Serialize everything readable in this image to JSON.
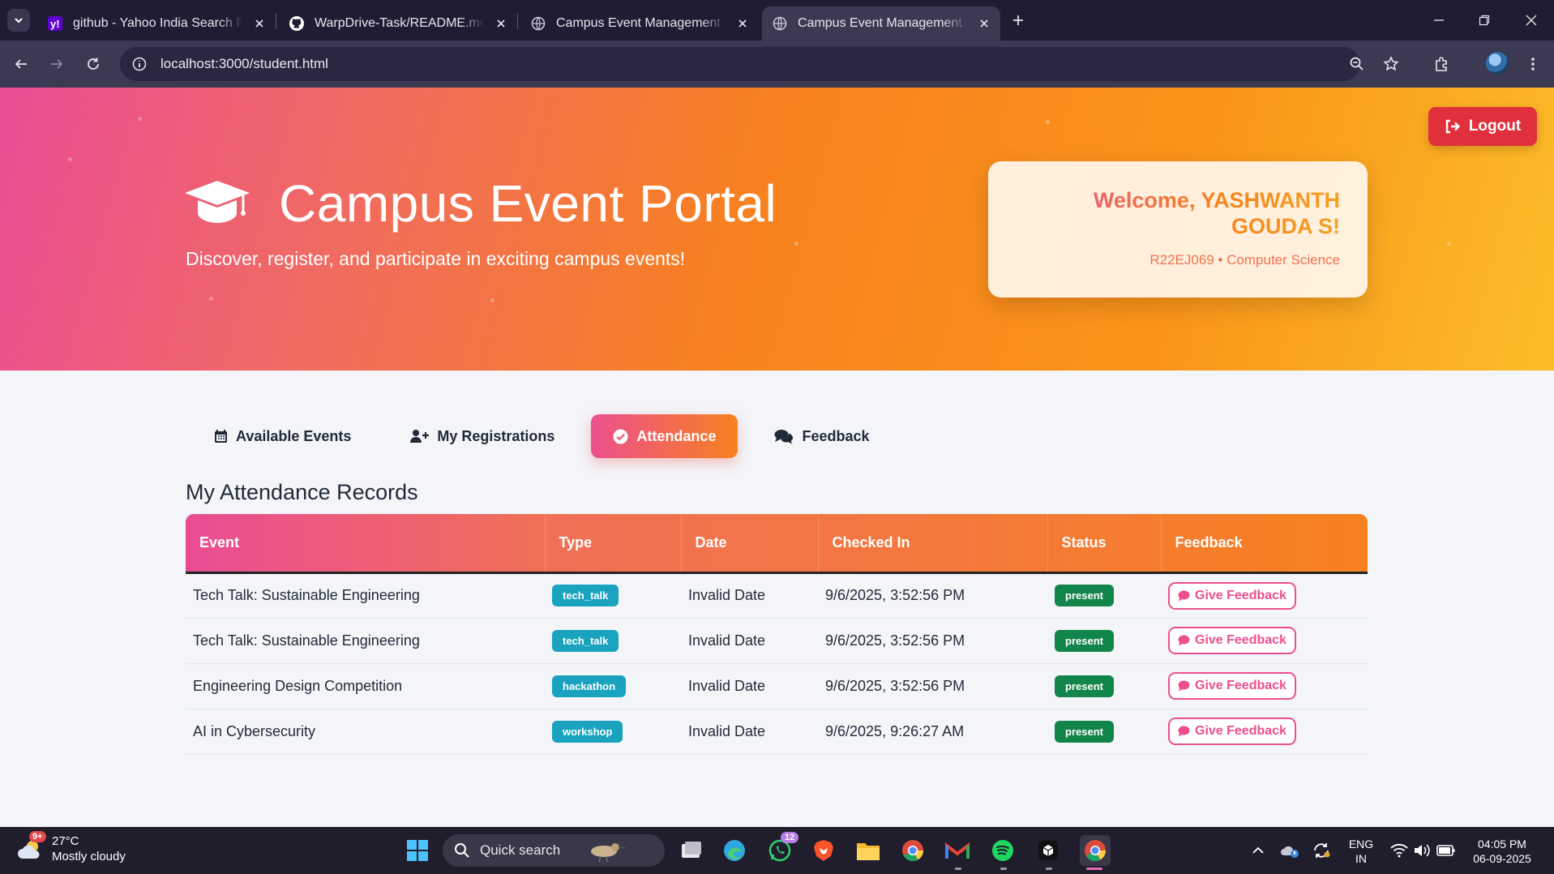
{
  "browser": {
    "tabs": [
      {
        "title": "github - Yahoo India Search Res",
        "icon": "yahoo-favicon"
      },
      {
        "title": "WarpDrive-Task/README.md at",
        "icon": "github-favicon"
      },
      {
        "title": "Campus Event Management Pla",
        "icon": "globe-favicon"
      },
      {
        "title": "Campus Event Management - S",
        "icon": "globe-favicon",
        "active": true
      }
    ],
    "url": "localhost:3000/student.html"
  },
  "hero": {
    "title": "Campus Event Portal",
    "tagline": "Discover, register, and participate in exciting campus events!",
    "logout_label": "Logout",
    "welcome_title": "Welcome, YASHWANTH GOUDA S!",
    "welcome_meta": "R22EJ069 • Computer Science"
  },
  "tabs": [
    {
      "label": "Available Events",
      "icon": "calendar-icon"
    },
    {
      "label": "My Registrations",
      "icon": "user-plus-icon"
    },
    {
      "label": "Attendance",
      "icon": "check-circle-icon",
      "active": true
    },
    {
      "label": "Feedback",
      "icon": "comments-icon"
    }
  ],
  "attendance": {
    "title": "My Attendance Records",
    "columns": [
      "Event",
      "Type",
      "Date",
      "Checked In",
      "Status",
      "Feedback"
    ],
    "rows": [
      {
        "event": "Tech Talk: Sustainable Engineering",
        "type": "tech_talk",
        "date": "Invalid Date",
        "checked_in": "9/6/2025, 3:52:56 PM",
        "status": "present",
        "action": "Give Feedback"
      },
      {
        "event": "Tech Talk: Sustainable Engineering",
        "type": "tech_talk",
        "date": "Invalid Date",
        "checked_in": "9/6/2025, 3:52:56 PM",
        "status": "present",
        "action": "Give Feedback"
      },
      {
        "event": "Engineering Design Competition",
        "type": "hackathon",
        "date": "Invalid Date",
        "checked_in": "9/6/2025, 3:52:56 PM",
        "status": "present",
        "action": "Give Feedback"
      },
      {
        "event": "AI in Cybersecurity",
        "type": "workshop",
        "date": "Invalid Date",
        "checked_in": "9/6/2025, 9:26:27 AM",
        "status": "present",
        "action": "Give Feedback"
      }
    ]
  },
  "taskbar": {
    "weather_badge": "9+",
    "temperature": "27°C",
    "condition": "Mostly cloudy",
    "search_label": "Quick search",
    "whatsapp_badge": "12",
    "lang": "ENG",
    "region": "IN",
    "time": "04:05 PM",
    "date": "06-09-2025"
  },
  "colors": {
    "accent_pink": "#ea4c95",
    "accent_orange": "#f7811f",
    "logout_red": "#e0303c",
    "type_badge": "#1aa3bf",
    "status_badge": "#12864a"
  }
}
